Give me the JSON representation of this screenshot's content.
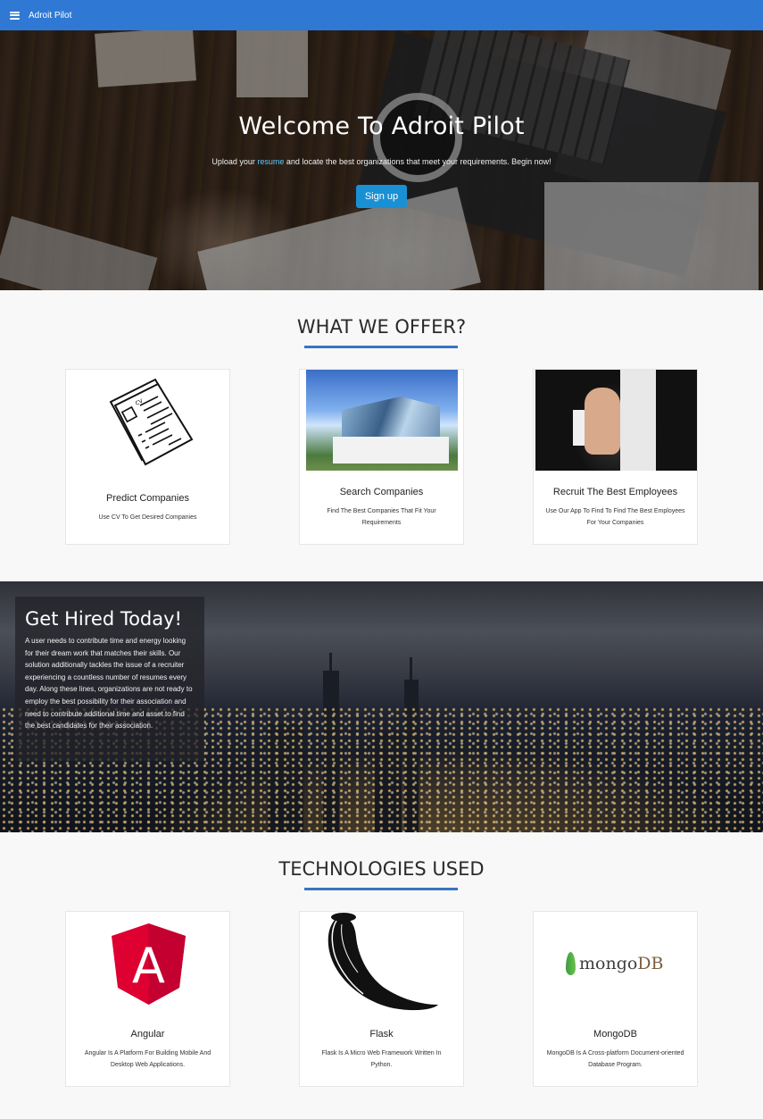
{
  "navbar": {
    "brand": "Adroit Pilot",
    "menu_icon": "hamburger-menu-icon",
    "color": "#2f78d4"
  },
  "hero": {
    "title": "Welcome To Adroit Pilot",
    "subtitle_pre": "Upload your ",
    "subtitle_link": "resume",
    "subtitle_post": " and locate the best organizations that meet your requirements. Begin now!",
    "signup_label": "Sign up",
    "button_color": "#1a90d4"
  },
  "offer": {
    "heading": "WHAT WE OFFER?",
    "accent": "#3a74c0",
    "cards": [
      {
        "title": "Predict Companies",
        "desc": "Use CV To Get Desired Companies",
        "image": "resume-documents-icon"
      },
      {
        "title": "Search Companies",
        "desc": "Find The Best Companies That Fit Your Requirements",
        "image": "office-building-image"
      },
      {
        "title": "Recruit The Best Employees",
        "desc": "Use Our App To Find To Find The Best Employees For Your Companies",
        "image": "thumbs-up-image"
      }
    ]
  },
  "hired": {
    "title": "Get Hired Today!",
    "text": "A user needs to contribute time and energy looking for their dream work that matches their skills. Our solution additionally tackles the issue of a recruiter experiencing a countless number of resumes every day. Along these lines, organizations are not ready to employ the best possibility for their association and need to contribute additional time and asset to find the best candidates for their association."
  },
  "tech": {
    "heading": "TECHNOLOGIES USED",
    "cards": [
      {
        "title": "Angular",
        "desc": "Angular Is A Platform For Building Mobile And Desktop Web Applications.",
        "image": "angular-logo",
        "logo_letter": "A",
        "logo_color": "#dd0031"
      },
      {
        "title": "Flask",
        "desc": "Flask Is A Micro Web Framework Written In Python.",
        "image": "flask-horn-logo"
      },
      {
        "title": "MongoDB",
        "desc": "MongoDB Is A Cross-platform Document-oriented Database Program.",
        "image": "mongodb-logo",
        "logo_text_a": "mongo",
        "logo_text_b": "DB",
        "leaf_color": "#4fa945"
      }
    ]
  }
}
